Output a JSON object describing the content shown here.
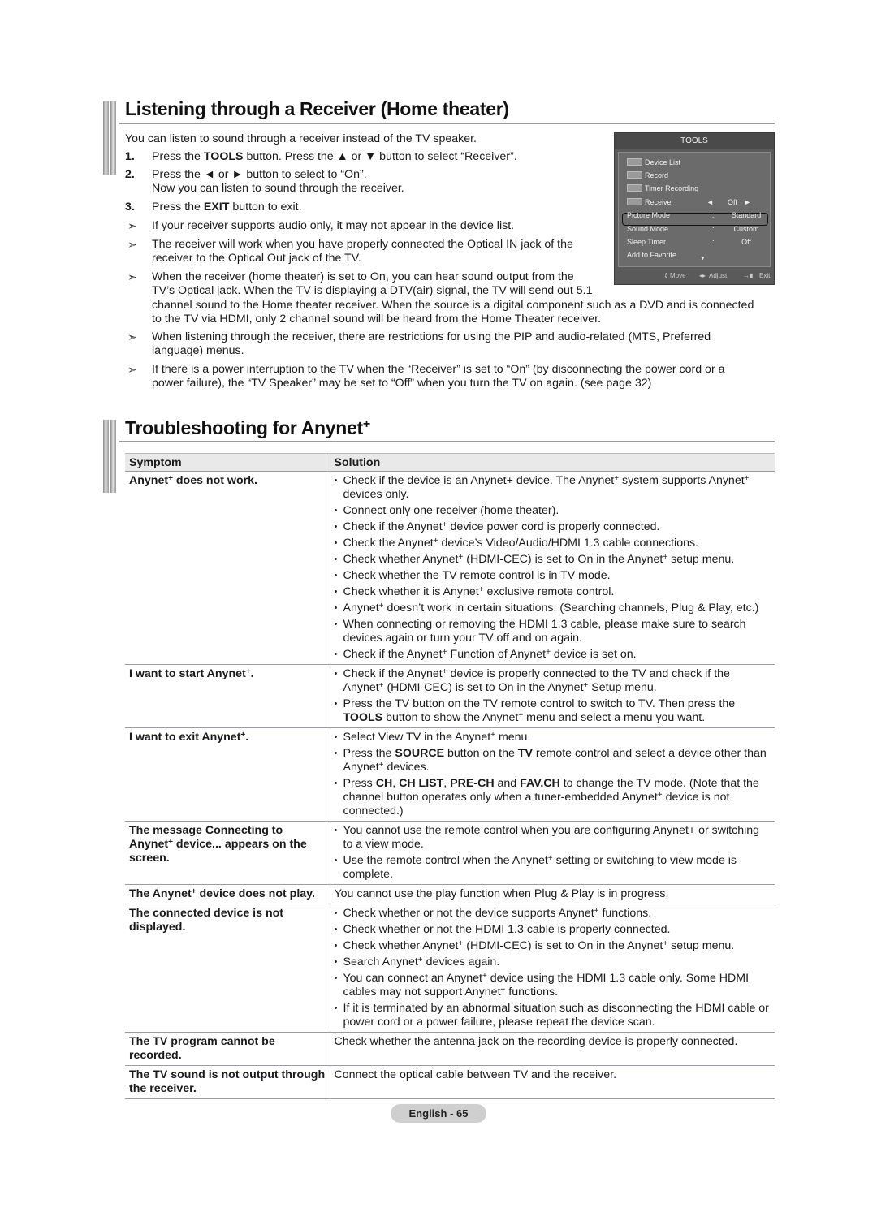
{
  "section1": {
    "title": "Listening through a Receiver (Home theater)",
    "intro": "You can listen to sound through a receiver instead of the TV speaker.",
    "steps": [
      {
        "num": "1.",
        "pre": "Press the ",
        "bold": "TOOLS",
        "post": " button. Press the ▲ or ▼ button to select “Receiver”."
      },
      {
        "num": "2.",
        "line1": "Press the ◄ or ► button to select to “On”.",
        "line2": "Now you can listen to sound through the receiver."
      },
      {
        "num": "3.",
        "pre": "Press the ",
        "bold": "EXIT",
        "post": " button to exit."
      }
    ],
    "notes": [
      "If your receiver supports audio only, it may not appear in the device list.",
      "The receiver will work when you have properly connected the Optical IN jack of the",
      "receiver to the Optical Out jack of the TV.",
      "When the receiver (home theater) is set to On, you can hear sound output from the",
      "TV’s Optical jack. When the TV is displaying a DTV(air) signal, the TV will send out 5.1",
      "channel sound to the Home theater receiver. When the source is a digital component such as a DVD and is connected",
      "to the TV via HDMI, only 2 channel sound will be heard from the Home Theater receiver.",
      "When listening through the receiver, there are restrictions for using the PIP and audio-related (MTS, Preferred",
      "language) menus.",
      "If there is a power interruption to the TV when the “Receiver” is set to “On” (by disconnecting the power cord or a",
      "power failure), the “TV Speaker” may be set to “Off” when you turn the TV on again. (see page 32)"
    ],
    "note_icon": "➣"
  },
  "osd": {
    "title": "TOOLS",
    "badge_icon": "anynet-badge-icon",
    "items": [
      {
        "label": "Device List"
      },
      {
        "label": "Record"
      },
      {
        "label": "Timer Recording"
      },
      {
        "label": "Receiver",
        "left": "◄",
        "value": "Off",
        "right": "►"
      },
      {
        "label": "Picture Mode",
        "colon": ":",
        "value": "Standard"
      },
      {
        "label": "Sound Mode",
        "colon": ":",
        "value": "Custom"
      },
      {
        "label": "Sleep Timer",
        "colon": ":",
        "value": "Off"
      },
      {
        "label": "Add to Favorite"
      }
    ],
    "down": "▼",
    "footer": {
      "move_icon": "⇕",
      "move": "Move",
      "adjust_icon": "◂▸",
      "adjust": "Adjust",
      "exit_icon": "→▮",
      "exit": "Exit"
    }
  },
  "section2": {
    "title": "Troubleshooting for Anynet",
    "title_sup": "+",
    "headers": {
      "symptom": "Symptom",
      "solution": "Solution"
    },
    "rows": [
      {
        "symptom": "Anynet+ does not work.",
        "solutions": [
          "Check if the device is an Anynet+ device. The Anynet+ system supports Anynet+ devices only.",
          "Connect only one receiver (home theater).",
          "Check if the Anynet+ device power cord is properly connected.",
          "Check the Anynet+ device’s Video/Audio/HDMI 1.3 cable connections.",
          "Check whether Anynet+ (HDMI-CEC) is set to On in the Anynet+ setup menu.",
          "Check whether the TV remote control is in TV mode.",
          "Check whether it is Anynet+ exclusive remote control.",
          "Anynet+ doesn’t work in certain situations. (Searching channels, Plug & Play, etc.)",
          "When connecting or removing the HDMI 1.3 cable, please make sure to search devices again or turn your TV off and on again.",
          "Check if the Anynet+ Function of Anynet+ device is set on."
        ]
      },
      {
        "symptom": "I want to start Anynet+.",
        "solutions": [
          "Check if the Anynet+ device is properly connected to the TV and check if the Anynet+ (HDMI-CEC) is set to On in the Anynet+ Setup menu.",
          "Press the TV button on the TV remote control to switch to TV. Then press the TOOLS button to show the Anynet+ menu and select a menu you want."
        ]
      },
      {
        "symptom": "I want to exit Anynet+.",
        "solutions": [
          "Select View TV in the Anynet+ menu.",
          "Press the SOURCE button on the TV remote control and select a device other than Anynet+ devices.",
          "Press CH, CH LIST, PRE-CH and FAV.CH to change the TV mode. (Note that the channel button operates only when a tuner-embedded Anynet+ device is not connected.)"
        ]
      },
      {
        "symptom": "The message Connecting to Anynet+ device... appears on the screen.",
        "solutions": [
          "You cannot use the remote control when you are configuring Anynet+ or switching to a view mode.",
          "Use the remote control when the Anynet+ setting or switching to view mode is complete."
        ]
      },
      {
        "symptom": "The Anynet+ device does not play.",
        "plain": "You cannot use the play function when Plug & Play is in progress."
      },
      {
        "symptom": "The connected device is not displayed.",
        "solutions": [
          "Check whether or not the device supports Anynet+ functions.",
          "Check whether or not the HDMI 1.3 cable is properly connected.",
          "Check whether Anynet+ (HDMI-CEC) is set to On in the Anynet+ setup menu.",
          "Search Anynet+ devices again.",
          "You can connect an Anynet+ device using the HDMI 1.3 cable only. Some HDMI cables may not support Anynet+ functions.",
          "If it is terminated by an abnormal situation such as disconnecting the HDMI cable or power cord or a power failure, please repeat the device scan."
        ]
      },
      {
        "symptom": "The TV program cannot be recorded.",
        "plain": "Check whether the antenna jack on the recording device is properly connected."
      },
      {
        "symptom": "The TV sound is not output through the receiver.",
        "plain": "Connect the optical cable between TV and the receiver."
      }
    ]
  },
  "footer": {
    "page_label": "English - 65"
  }
}
